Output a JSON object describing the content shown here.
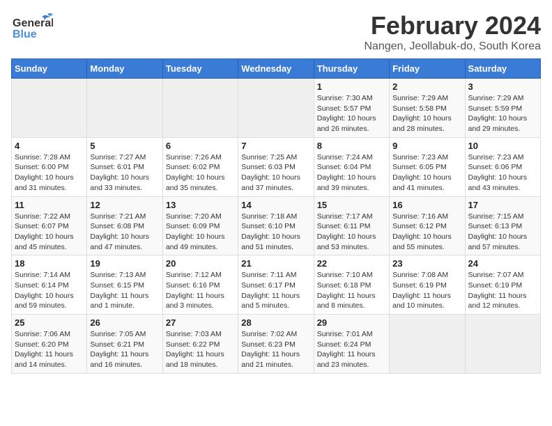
{
  "logo": {
    "line1": "General",
    "line2": "Blue"
  },
  "title": "February 2024",
  "subtitle": "Nangen, Jeollabuk-do, South Korea",
  "weekdays": [
    "Sunday",
    "Monday",
    "Tuesday",
    "Wednesday",
    "Thursday",
    "Friday",
    "Saturday"
  ],
  "weeks": [
    [
      {
        "day": "",
        "info": ""
      },
      {
        "day": "",
        "info": ""
      },
      {
        "day": "",
        "info": ""
      },
      {
        "day": "",
        "info": ""
      },
      {
        "day": "1",
        "info": "Sunrise: 7:30 AM\nSunset: 5:57 PM\nDaylight: 10 hours\nand 26 minutes."
      },
      {
        "day": "2",
        "info": "Sunrise: 7:29 AM\nSunset: 5:58 PM\nDaylight: 10 hours\nand 28 minutes."
      },
      {
        "day": "3",
        "info": "Sunrise: 7:29 AM\nSunset: 5:59 PM\nDaylight: 10 hours\nand 29 minutes."
      }
    ],
    [
      {
        "day": "4",
        "info": "Sunrise: 7:28 AM\nSunset: 6:00 PM\nDaylight: 10 hours\nand 31 minutes."
      },
      {
        "day": "5",
        "info": "Sunrise: 7:27 AM\nSunset: 6:01 PM\nDaylight: 10 hours\nand 33 minutes."
      },
      {
        "day": "6",
        "info": "Sunrise: 7:26 AM\nSunset: 6:02 PM\nDaylight: 10 hours\nand 35 minutes."
      },
      {
        "day": "7",
        "info": "Sunrise: 7:25 AM\nSunset: 6:03 PM\nDaylight: 10 hours\nand 37 minutes."
      },
      {
        "day": "8",
        "info": "Sunrise: 7:24 AM\nSunset: 6:04 PM\nDaylight: 10 hours\nand 39 minutes."
      },
      {
        "day": "9",
        "info": "Sunrise: 7:23 AM\nSunset: 6:05 PM\nDaylight: 10 hours\nand 41 minutes."
      },
      {
        "day": "10",
        "info": "Sunrise: 7:23 AM\nSunset: 6:06 PM\nDaylight: 10 hours\nand 43 minutes."
      }
    ],
    [
      {
        "day": "11",
        "info": "Sunrise: 7:22 AM\nSunset: 6:07 PM\nDaylight: 10 hours\nand 45 minutes."
      },
      {
        "day": "12",
        "info": "Sunrise: 7:21 AM\nSunset: 6:08 PM\nDaylight: 10 hours\nand 47 minutes."
      },
      {
        "day": "13",
        "info": "Sunrise: 7:20 AM\nSunset: 6:09 PM\nDaylight: 10 hours\nand 49 minutes."
      },
      {
        "day": "14",
        "info": "Sunrise: 7:18 AM\nSunset: 6:10 PM\nDaylight: 10 hours\nand 51 minutes."
      },
      {
        "day": "15",
        "info": "Sunrise: 7:17 AM\nSunset: 6:11 PM\nDaylight: 10 hours\nand 53 minutes."
      },
      {
        "day": "16",
        "info": "Sunrise: 7:16 AM\nSunset: 6:12 PM\nDaylight: 10 hours\nand 55 minutes."
      },
      {
        "day": "17",
        "info": "Sunrise: 7:15 AM\nSunset: 6:13 PM\nDaylight: 10 hours\nand 57 minutes."
      }
    ],
    [
      {
        "day": "18",
        "info": "Sunrise: 7:14 AM\nSunset: 6:14 PM\nDaylight: 10 hours\nand 59 minutes."
      },
      {
        "day": "19",
        "info": "Sunrise: 7:13 AM\nSunset: 6:15 PM\nDaylight: 11 hours\nand 1 minute."
      },
      {
        "day": "20",
        "info": "Sunrise: 7:12 AM\nSunset: 6:16 PM\nDaylight: 11 hours\nand 3 minutes."
      },
      {
        "day": "21",
        "info": "Sunrise: 7:11 AM\nSunset: 6:17 PM\nDaylight: 11 hours\nand 5 minutes."
      },
      {
        "day": "22",
        "info": "Sunrise: 7:10 AM\nSunset: 6:18 PM\nDaylight: 11 hours\nand 8 minutes."
      },
      {
        "day": "23",
        "info": "Sunrise: 7:08 AM\nSunset: 6:19 PM\nDaylight: 11 hours\nand 10 minutes."
      },
      {
        "day": "24",
        "info": "Sunrise: 7:07 AM\nSunset: 6:19 PM\nDaylight: 11 hours\nand 12 minutes."
      }
    ],
    [
      {
        "day": "25",
        "info": "Sunrise: 7:06 AM\nSunset: 6:20 PM\nDaylight: 11 hours\nand 14 minutes."
      },
      {
        "day": "26",
        "info": "Sunrise: 7:05 AM\nSunset: 6:21 PM\nDaylight: 11 hours\nand 16 minutes."
      },
      {
        "day": "27",
        "info": "Sunrise: 7:03 AM\nSunset: 6:22 PM\nDaylight: 11 hours\nand 18 minutes."
      },
      {
        "day": "28",
        "info": "Sunrise: 7:02 AM\nSunset: 6:23 PM\nDaylight: 11 hours\nand 21 minutes."
      },
      {
        "day": "29",
        "info": "Sunrise: 7:01 AM\nSunset: 6:24 PM\nDaylight: 11 hours\nand 23 minutes."
      },
      {
        "day": "",
        "info": ""
      },
      {
        "day": "",
        "info": ""
      }
    ]
  ]
}
